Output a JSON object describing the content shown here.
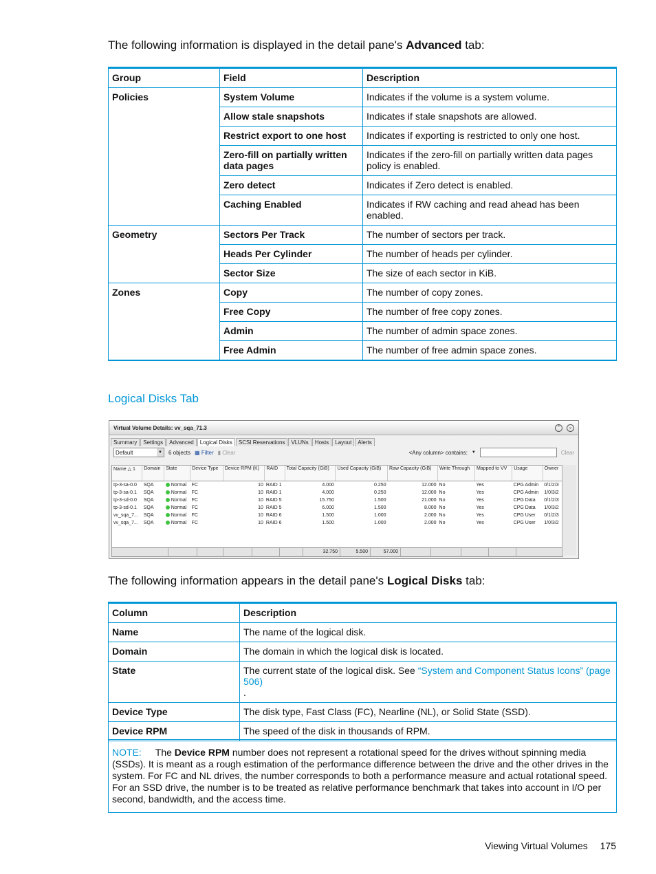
{
  "intro_advanced": {
    "before": "The following information is displayed in the detail pane's ",
    "bold": "Advanced",
    "after": " tab:"
  },
  "advanced_table": {
    "headers": [
      "Group",
      "Field",
      "Description"
    ],
    "rows": [
      {
        "group": "Policies",
        "field": "System Volume",
        "desc": "Indicates if the volume is a system volume."
      },
      {
        "group": "",
        "field": "Allow stale snapshots",
        "desc": "Indicates if stale snapshots are allowed."
      },
      {
        "group": "",
        "field": "Restrict export to one host",
        "desc": "Indicates if exporting is restricted to only one host."
      },
      {
        "group": "",
        "field": "Zero-fill on partially written data pages",
        "desc": "Indicates if the zero-fill on partially written data pages policy is enabled."
      },
      {
        "group": "",
        "field": "Zero detect",
        "desc": "Indicates if Zero detect is enabled."
      },
      {
        "group": "",
        "field": "Caching Enabled",
        "desc": "Indicates if RW caching and read ahead has been enabled."
      },
      {
        "group": "Geometry",
        "field": "Sectors Per Track",
        "desc": "The number of sectors per track."
      },
      {
        "group": "",
        "field": "Heads Per Cylinder",
        "desc": "The number of heads per cylinder."
      },
      {
        "group": "",
        "field": "Sector Size",
        "desc": "The size of each sector in KiB."
      },
      {
        "group": "Zones",
        "field": "Copy",
        "desc": "The number of copy zones."
      },
      {
        "group": "",
        "field": "Free Copy",
        "desc": "The number of free copy zones."
      },
      {
        "group": "",
        "field": "Admin",
        "desc": "The number of admin space zones."
      },
      {
        "group": "",
        "field": "Free Admin",
        "desc": "The number of free admin space zones."
      }
    ]
  },
  "section_title": "Logical Disks Tab",
  "screenshot": {
    "title": "Virtual Volume Details: vv_sqa_71.3",
    "tabs": [
      "Summary",
      "Settings",
      "Advanced",
      "Logical Disks",
      "SCSI Reservations",
      "VLUNs",
      "Hosts",
      "Layout",
      "Alerts"
    ],
    "active_tab": "Logical Disks",
    "view_select": "Default",
    "object_count": "6 objects",
    "filter_label": "Filter",
    "clear_label": "Clear",
    "column_filter": "<Any column> contains:",
    "search_clear": "Clear",
    "columns": [
      "Name △ 1",
      "Domain",
      "State",
      "Device Type",
      "Device RPM (K)",
      "RAID",
      "Total Capacity (GiB)",
      "Used Capacity (GiB)",
      "Raw Capacity (GiB)",
      "Write Through",
      "Mapped to VV",
      "Usage",
      "Owner"
    ],
    "rows": [
      [
        "tp-3-sa-0.0",
        "SQA",
        "Normal",
        "FC",
        "10",
        "RAID 1",
        "4.000",
        "0.250",
        "12.000",
        "No",
        "Yes",
        "CPG Admin",
        "0/1/2/3"
      ],
      [
        "tp-3-sa-0.1",
        "SQA",
        "Normal",
        "FC",
        "10",
        "RAID 1",
        "4.000",
        "0.250",
        "12.000",
        "No",
        "Yes",
        "CPG Admin",
        "1/0/3/2"
      ],
      [
        "tp-3-sd-0.0",
        "SQA",
        "Normal",
        "FC",
        "10",
        "RAID 5",
        "15.750",
        "1.500",
        "21.000",
        "No",
        "Yes",
        "CPG Data",
        "0/1/2/3"
      ],
      [
        "tp-3-sd-0.1",
        "SQA",
        "Normal",
        "FC",
        "10",
        "RAID 5",
        "6.000",
        "1.500",
        "8.000",
        "No",
        "Yes",
        "CPG Data",
        "1/0/3/2"
      ],
      [
        "vv_sqa_7...",
        "SQA",
        "Normal",
        "FC",
        "10",
        "RAID 6",
        "1.500",
        "1.000",
        "2.000",
        "No",
        "Yes",
        "CPG User",
        "0/1/2/3"
      ],
      [
        "vv_sqa_7...",
        "SQA",
        "Normal",
        "FC",
        "10",
        "RAID 6",
        "1.500",
        "1.000",
        "2.000",
        "No",
        "Yes",
        "CPG User",
        "1/0/3/2"
      ]
    ],
    "totals": {
      "total_capacity": "32.750",
      "used_capacity": "5.500",
      "raw_capacity": "57.000"
    },
    "status_color": "#3ec43e"
  },
  "intro_logical": {
    "before": "The following information appears in the detail pane's ",
    "bold": "Logical Disks",
    "after": " tab:"
  },
  "logical_table": {
    "headers": [
      "Column",
      "Description"
    ],
    "rows": [
      {
        "col": "Name",
        "desc": "The name of the logical disk."
      },
      {
        "col": "Domain",
        "desc": "The domain in which the logical disk is located."
      },
      {
        "col": "State",
        "desc": "The current state of the logical disk. See ",
        "link": "“System and Component Status Icons” (page 506)",
        "after": "."
      },
      {
        "col": "Device Type",
        "desc": "The disk type, Fast Class (FC), Nearline (NL), or Solid State (SSD)."
      },
      {
        "col": "Device RPM",
        "desc": "The speed of the disk in thousands of RPM."
      }
    ]
  },
  "note": {
    "label": "NOTE:",
    "before": "The ",
    "bold": "Device RPM",
    "text": " number does not represent a rotational speed for the drives without spinning media (SSDs). It is meant as a rough estimation of the performance difference between the drive and the other drives in the system. For FC and NL drives, the number corresponds to both a performance measure and actual rotational speed. For an SSD drive, the number is to be treated as relative performance benchmark that takes into account in I/O per second, bandwidth, and the access time."
  },
  "page_footer": {
    "section": "Viewing Virtual Volumes",
    "page": "175"
  },
  "colors": {
    "accent": "#0096d6"
  }
}
